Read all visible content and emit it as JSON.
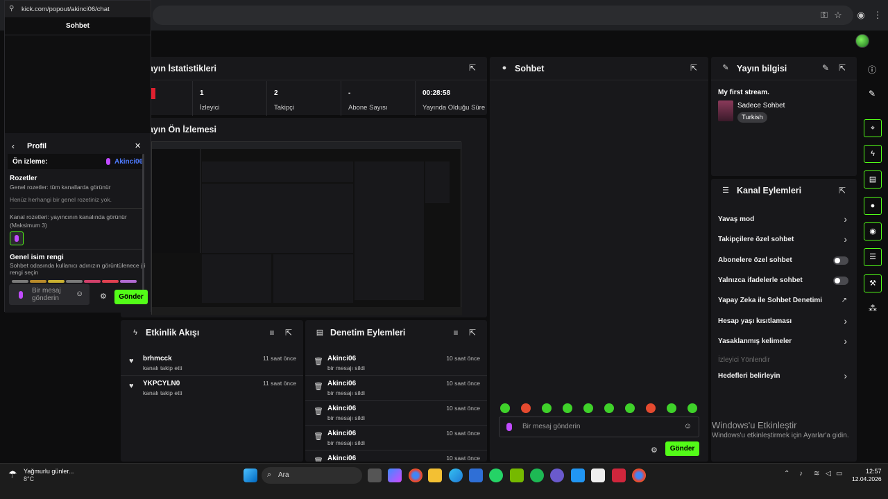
{
  "browser": {
    "popup_url": "kick.com/popout/akinci06/chat"
  },
  "stats_panel": {
    "title": "ayın İstatistikleri",
    "items": [
      {
        "value": "1",
        "label": "İzleyici"
      },
      {
        "value": "2",
        "label": "Takipçi"
      },
      {
        "value": "-",
        "label": "Abone Sayısı"
      },
      {
        "value": "00:28:58",
        "label": "Yayında Olduğu Süre"
      }
    ]
  },
  "preview_panel": {
    "title": "ayın Ön İzlemesi"
  },
  "chat_panel": {
    "title": "Sohbet",
    "placeholder": "Bir mesaj gönderin",
    "send_label": "Gönder"
  },
  "stream_info": {
    "title": "Yayın bilgisi",
    "stream_title": "My first stream.",
    "category": "Sadece Sohbet",
    "language": "Turkish"
  },
  "channel_actions": {
    "title": "Kanal Eylemleri",
    "items": [
      {
        "label": "Yavaş mod",
        "control": "chevron"
      },
      {
        "label": "Takipçilere özel sohbet",
        "control": "chevron"
      },
      {
        "label": "Abonelere özel sohbet",
        "control": "toggle"
      },
      {
        "label": "Yalnızca ifadelerle sohbet",
        "control": "toggle"
      },
      {
        "label": "Yapay Zeka ile Sohbet Denetimi",
        "control": "external"
      },
      {
        "label": "Hesap yaşı kısıtlaması",
        "control": "chevron"
      },
      {
        "label": "Yasaklanmış kelimeler",
        "control": "chevron"
      },
      {
        "label": "İzleyici Yönlendir",
        "control": "disabled"
      },
      {
        "label": "Hedefleri belirleyin",
        "control": "chevron"
      }
    ]
  },
  "activity": {
    "title": "Etkinlik Akışı",
    "items": [
      {
        "name": "brhmcck",
        "sub": "kanalı takip etti",
        "time": "11 saat önce"
      },
      {
        "name": "YKPCYLN0",
        "sub": "kanalı takip etti",
        "time": "11 saat önce"
      }
    ]
  },
  "moderation": {
    "title": "Denetim Eylemleri",
    "items": [
      {
        "name": "Akinci06",
        "sub": "bir mesajı sildi",
        "time": "10 saat önce"
      },
      {
        "name": "Akinci06",
        "sub": "bir mesajı sildi",
        "time": "10 saat önce"
      },
      {
        "name": "Akinci06",
        "sub": "bir mesajı sildi",
        "time": "10 saat önce"
      },
      {
        "name": "Akinci06",
        "sub": "bir mesajı sildi",
        "time": "10 saat önce"
      },
      {
        "name": "Akinci06",
        "sub": "",
        "time": "10 saat önce"
      }
    ]
  },
  "popup": {
    "header": "Sohbet",
    "profile_title": "Profil",
    "preview_label": "Ön izleme:",
    "preview_user": "Akinci06",
    "badges_title": "Rozetler",
    "badges_sub": "Genel rozetler: tüm kanallarda görünür",
    "badges_empty": "Henüz herhangi bir genel rozetiniz yok.",
    "channel_badges": "Kanal rozetleri: yayıncının kanalında görünür (Maksimum 3)",
    "color_title": "Genel isim rengi",
    "color_sub": "Sohbet odasında kullanıcı adınızın görüntülenece ği rengi seçin",
    "placeholder": "Bir mesaj gönderin",
    "send_label": "Gönder"
  },
  "windows": {
    "activate_title": "Windows'u Etkinleştir",
    "activate_sub": "Windows'u etkinleştirmek için Ayarlar'a gidin."
  },
  "taskbar": {
    "weather_title": "Yağmurlu günler...",
    "weather_temp": "8°C",
    "search": "Ara",
    "time": "12:57",
    "date": "12.04.2026"
  },
  "colors": {
    "accent": "#53fc18",
    "panel": "#18181b",
    "bg": "#0d0d0e",
    "badge_purple": "#c14bff"
  }
}
